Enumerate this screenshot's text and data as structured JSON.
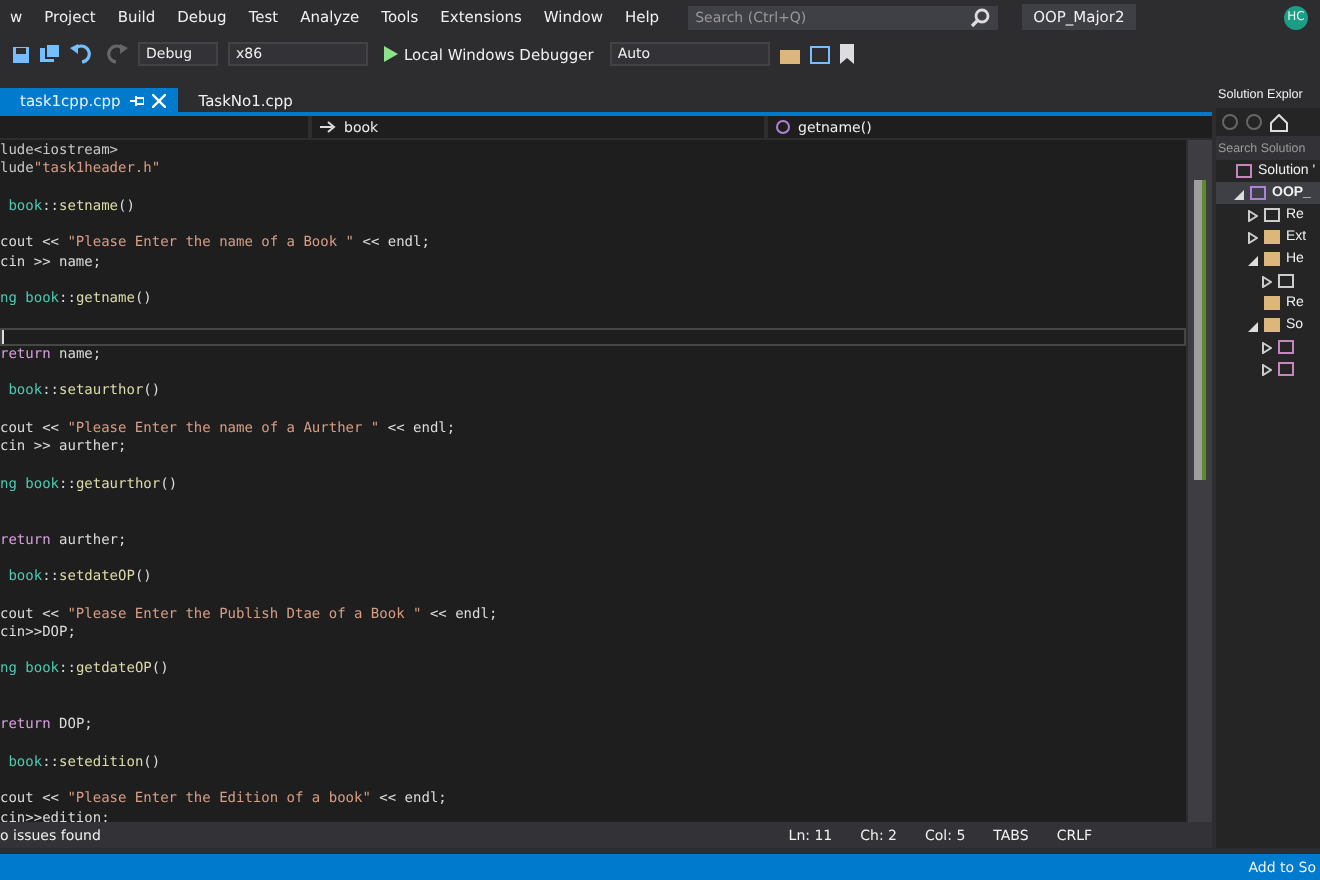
{
  "menu": {
    "items": [
      "w",
      "Project",
      "Build",
      "Debug",
      "Test",
      "Analyze",
      "Tools",
      "Extensions",
      "Window",
      "Help"
    ],
    "search": {
      "placeholder": "Search (Ctrl+Q)"
    },
    "solution_name": "OOP_Major2",
    "avatar": "HC"
  },
  "toolbar": {
    "configuration": "Debug",
    "platform": "x86",
    "run_label": "Local Windows Debugger",
    "target": "Auto"
  },
  "tabs": [
    {
      "label": "task1cpp.cpp",
      "selected": true
    },
    {
      "label": "TaskNo1.cpp",
      "selected": false
    }
  ],
  "navigation": {
    "class": "book",
    "member": "getname()"
  },
  "code": {
    "lines": [
      {
        "kind": "code",
        "segments": [
          {
            "text": "lude<iostream>",
            "color": "#c8c8c8"
          }
        ]
      },
      {
        "kind": "code",
        "segments": [
          {
            "text": "lude",
            "color": "#c8c8c8"
          },
          {
            "text": "\"task1header.h\"",
            "color": "#d69d85"
          }
        ]
      },
      {
        "kind": "blank"
      },
      {
        "kind": "code",
        "segments": [
          {
            "text": " book",
            "color": "#4ec9b0"
          },
          {
            "text": "::",
            "color": "#dcdcdc"
          },
          {
            "text": "setname",
            "color": "#dcdcaa"
          },
          {
            "text": "()",
            "color": "#dcdcdc"
          }
        ]
      },
      {
        "kind": "blank"
      },
      {
        "kind": "code",
        "segments": [
          {
            "text": "cout << ",
            "color": "#dcdcdc"
          },
          {
            "text": "\"Please Enter the name of a Book \"",
            "color": "#d69d85"
          },
          {
            "text": " << endl;",
            "color": "#dcdcdc"
          }
        ]
      },
      {
        "kind": "code",
        "segments": [
          {
            "text": "cin >> name;",
            "color": "#dcdcdc"
          }
        ]
      },
      {
        "kind": "blank"
      },
      {
        "kind": "code",
        "segments": [
          {
            "text": "ng book",
            "color": "#4ec9b0"
          },
          {
            "text": "::",
            "color": "#dcdcdc"
          },
          {
            "text": "getname",
            "color": "#dcdcaa"
          },
          {
            "text": "()",
            "color": "#dcdcdc"
          }
        ]
      },
      {
        "kind": "blank"
      },
      {
        "kind": "cursor"
      },
      {
        "kind": "code",
        "segments": [
          {
            "text": "return",
            "color": "#d8a0df"
          },
          {
            "text": " name;",
            "color": "#dcdcdc"
          }
        ]
      },
      {
        "kind": "blank"
      },
      {
        "kind": "code",
        "segments": [
          {
            "text": " book",
            "color": "#4ec9b0"
          },
          {
            "text": "::",
            "color": "#dcdcdc"
          },
          {
            "text": "setaurthor",
            "color": "#dcdcaa"
          },
          {
            "text": "()",
            "color": "#dcdcdc"
          }
        ]
      },
      {
        "kind": "blank"
      },
      {
        "kind": "code",
        "segments": [
          {
            "text": "cout << ",
            "color": "#dcdcdc"
          },
          {
            "text": "\"Please Enter the name of a Aurther \"",
            "color": "#d69d85"
          },
          {
            "text": " << endl;",
            "color": "#dcdcdc"
          }
        ]
      },
      {
        "kind": "code",
        "segments": [
          {
            "text": "cin >> aurther;",
            "color": "#dcdcdc"
          }
        ]
      },
      {
        "kind": "blank"
      },
      {
        "kind": "code",
        "segments": [
          {
            "text": "ng book",
            "color": "#4ec9b0"
          },
          {
            "text": "::",
            "color": "#dcdcdc"
          },
          {
            "text": "getaurthor",
            "color": "#dcdcaa"
          },
          {
            "text": "()",
            "color": "#dcdcdc"
          }
        ]
      },
      {
        "kind": "blank"
      },
      {
        "kind": "blank"
      },
      {
        "kind": "code",
        "segments": [
          {
            "text": "return",
            "color": "#d8a0df"
          },
          {
            "text": " aurther;",
            "color": "#dcdcdc"
          }
        ]
      },
      {
        "kind": "blank"
      },
      {
        "kind": "code",
        "segments": [
          {
            "text": " book",
            "color": "#4ec9b0"
          },
          {
            "text": "::",
            "color": "#dcdcdc"
          },
          {
            "text": "setdateOP",
            "color": "#dcdcaa"
          },
          {
            "text": "()",
            "color": "#dcdcdc"
          }
        ]
      },
      {
        "kind": "blank"
      },
      {
        "kind": "code",
        "segments": [
          {
            "text": "cout << ",
            "color": "#dcdcdc"
          },
          {
            "text": "\"Please Enter the Publish Dtae of a Book \"",
            "color": "#d69d85"
          },
          {
            "text": " << endl;",
            "color": "#dcdcdc"
          }
        ]
      },
      {
        "kind": "code",
        "segments": [
          {
            "text": "cin>>DOP;",
            "color": "#dcdcdc"
          }
        ]
      },
      {
        "kind": "blank"
      },
      {
        "kind": "code",
        "segments": [
          {
            "text": "ng book",
            "color": "#4ec9b0"
          },
          {
            "text": "::",
            "color": "#dcdcdc"
          },
          {
            "text": "getdateOP",
            "color": "#dcdcaa"
          },
          {
            "text": "()",
            "color": "#dcdcdc"
          }
        ]
      },
      {
        "kind": "blank"
      },
      {
        "kind": "blank"
      },
      {
        "kind": "code",
        "segments": [
          {
            "text": "return",
            "color": "#d8a0df"
          },
          {
            "text": " DOP;",
            "color": "#dcdcdc"
          }
        ]
      },
      {
        "kind": "blank"
      },
      {
        "kind": "code",
        "segments": [
          {
            "text": " book",
            "color": "#4ec9b0"
          },
          {
            "text": "::",
            "color": "#dcdcdc"
          },
          {
            "text": "setedition",
            "color": "#dcdcaa"
          },
          {
            "text": "()",
            "color": "#dcdcdc"
          }
        ]
      },
      {
        "kind": "blank"
      },
      {
        "kind": "code",
        "segments": [
          {
            "text": "cout << ",
            "color": "#dcdcdc"
          },
          {
            "text": "\"Please Enter the Edition of a book\"",
            "color": "#d69d85"
          },
          {
            "text": " << endl;",
            "color": "#dcdcdc"
          }
        ]
      },
      {
        "kind": "code",
        "segments": [
          {
            "text": "cin>>edition;",
            "color": "#dcdcdc"
          }
        ]
      }
    ]
  },
  "error_bar": {
    "message": "o issues found"
  },
  "status_bar": {
    "line": "Ln: 11",
    "char": "Ch: 2",
    "col": "Col: 5",
    "indent": "TABS",
    "line_ending": "CRLF",
    "source_control": "Add to So"
  },
  "solution_explorer": {
    "title": "Solution Explor",
    "search": {
      "placeholder": "Search Solution"
    },
    "tree": [
      {
        "label": "Solution '",
        "kind": "solution",
        "children": [
          {
            "label": "OOP_",
            "kind": "project",
            "selected": true,
            "expanded": true,
            "children": [
              {
                "label": "Re",
                "kind": "refs",
                "expanded": false
              },
              {
                "label": "Ext",
                "kind": "folder",
                "expanded": false
              },
              {
                "label": "He",
                "kind": "folder",
                "expanded": true,
                "children": [
                  {
                    "kind": "header",
                    "expanded": false
                  }
                ]
              },
              {
                "label": "Re",
                "kind": "folder"
              },
              {
                "label": "So",
                "kind": "folder",
                "expanded": true,
                "children": [
                  {
                    "kind": "cpp",
                    "expanded": false
                  },
                  {
                    "kind": "cpp",
                    "expanded": false
                  }
                ]
              }
            ]
          }
        ]
      }
    ]
  }
}
